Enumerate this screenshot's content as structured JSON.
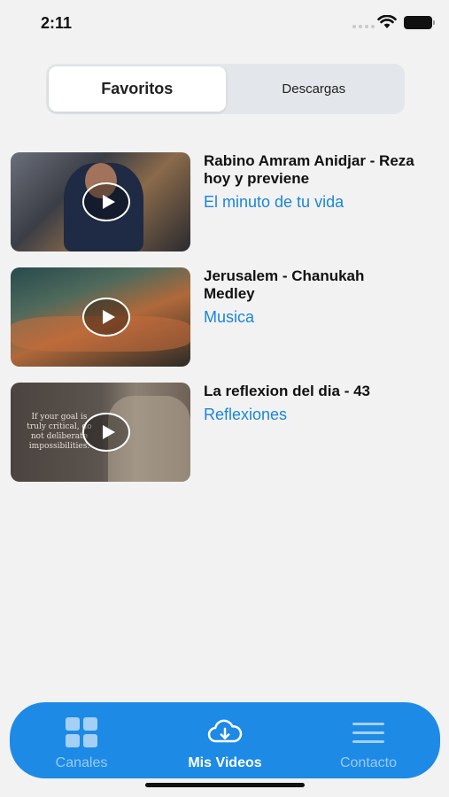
{
  "status_bar": {
    "time": "2:11"
  },
  "segmented": {
    "tabs": [
      "Favoritos",
      "Descargas"
    ],
    "selected": "Favoritos"
  },
  "videos": [
    {
      "title": "Rabino Amram Anidjar - Reza hoy y previene",
      "channel": "El minuto de tu vida"
    },
    {
      "title": "Jerusalem - Chanukah Medley",
      "channel": "Musica"
    },
    {
      "title": "La reflexion del dia - 43",
      "channel": "Reflexiones",
      "thumb_text": "If your goal is truly critical, do not deliberate impossibilities."
    }
  ],
  "tab_bar": {
    "tabs": [
      {
        "label": "Canales",
        "icon": "grid-icon"
      },
      {
        "label": "Mis Videos",
        "icon": "cloud-download-icon"
      },
      {
        "label": "Contacto",
        "icon": "menu-icon"
      }
    ],
    "active": "Mis Videos"
  },
  "colors": {
    "accent": "#1d8ae6",
    "link": "#1a86d9",
    "background": "#f2f2f2"
  }
}
